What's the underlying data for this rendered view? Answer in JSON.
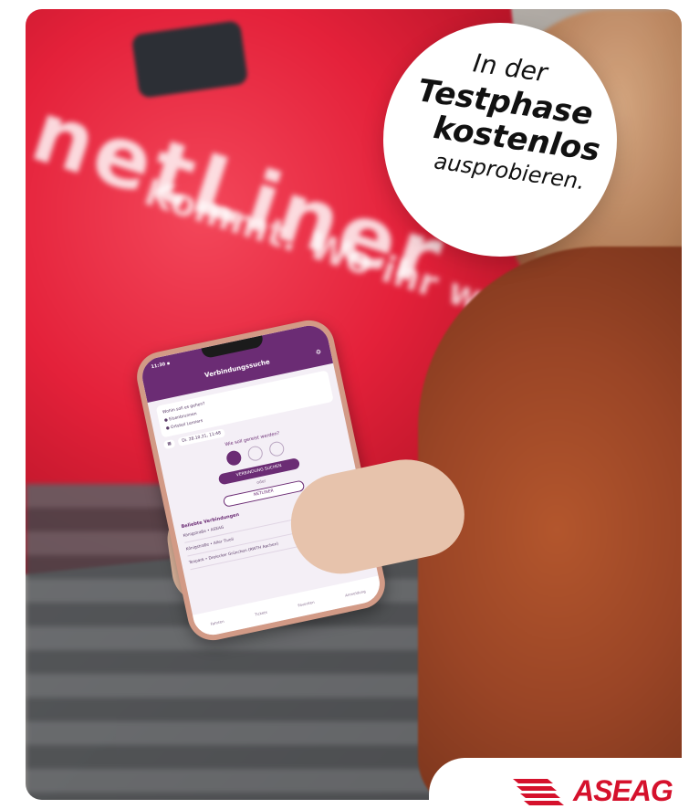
{
  "bubble": {
    "line1": "In der",
    "line2": "Testphase",
    "line3": "kostenlos",
    "line4": "ausprobieren."
  },
  "brand": {
    "name": "ASEAG",
    "color": "#d5112c"
  },
  "phone": {
    "header_title": "Verbindungssuche",
    "question_from": "Wohin soll es gehen?",
    "from": "Eisenbrunnen",
    "to": "Ortsteil Lemiers",
    "time": "Di. 28.10.21, 11:48",
    "how_question": "Wie soll gereist werden?",
    "search_button": "VERBINDUNG SUCHEN",
    "or_label": "oder",
    "netliner_button": "NETLINER",
    "favorites_title": "Beliebte Verbindungen",
    "favorites": [
      "Königstraße • ASEAG",
      "Königstraße • Aller Tivoli",
      "Tenpark • Dreiecker Grünchen (RWTH Aachen)"
    ],
    "tabs": [
      "Fahrten",
      "Tickets",
      "Favoriten",
      "Anmeldung"
    ]
  },
  "van_text": {
    "line1": "netLiner",
    "line2": "Kommt. Wo ihr wollt."
  }
}
